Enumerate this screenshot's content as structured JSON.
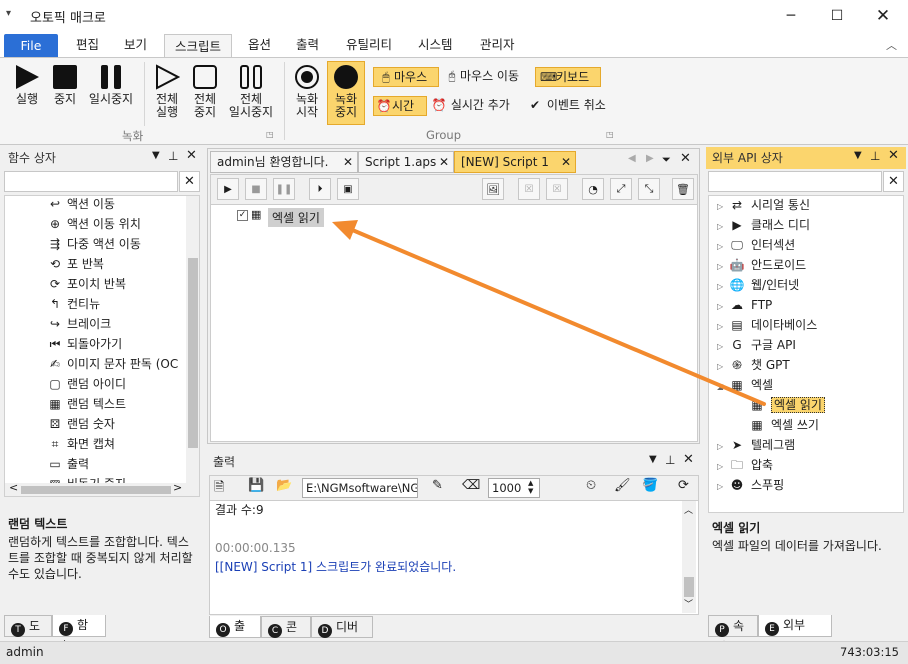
{
  "app": {
    "title": "오토픽 매크로"
  },
  "menu": {
    "items": [
      "File",
      "편집",
      "보기",
      "스크립트",
      "옵션",
      "출력",
      "유틸리티",
      "시스템",
      "관리자"
    ],
    "active": "스크립트"
  },
  "ribbon": {
    "run": "실행",
    "stop": "중지",
    "pause": "일시중지",
    "all_run": [
      "전체",
      "실행"
    ],
    "all_stop": [
      "전체",
      "중지"
    ],
    "all_pause": [
      "전체",
      "일시중지"
    ],
    "rec_start": [
      "녹화",
      "시작"
    ],
    "rec_stop": [
      "녹화",
      "중지"
    ],
    "mouse": "마우스",
    "mouse_move": "마우스 이동",
    "keyboard": "키보드",
    "time": "시간",
    "realtime_add": "실시간 추가",
    "event_cancel": "이벤트 취소",
    "group1": "녹화",
    "group2": "Group"
  },
  "left_panel": {
    "title": "함수 상자",
    "items": [
      "액션 이동",
      "액션 이동 위치",
      "다중 액션 이동",
      "포 반복",
      "포이치 반복",
      "컨티뉴",
      "브레이크",
      "되돌아가기",
      "이미지 문자 판독 (OC",
      "랜덤 아이디",
      "랜덤 텍스트",
      "랜덤 숫자",
      "화면 캡쳐",
      "출력",
      "비동기 중지"
    ],
    "desc_title": "랜덤 텍스트",
    "desc": "랜덤하게 텍스트를 조합합니다. 텍스트를 조합할 때 중복되지 않게 처리할수도 있습니다.",
    "tabs": [
      "도구",
      "함수"
    ]
  },
  "doc_tabs": [
    "admin님 환영합니다.",
    "Script 1.aps",
    "[NEW] Script 1"
  ],
  "script": {
    "node": "엑셀 읽기"
  },
  "output": {
    "title": "출력",
    "path": "E:\\NGMsoftware\\NG",
    "interval": "1000",
    "lines": [
      "결과 수:9",
      "",
      "00:00:00.135",
      "[[NEW] Script 1] 스크립트가 완료되었습니다."
    ],
    "tabs": [
      "출력",
      "콘솔",
      "디버그"
    ]
  },
  "right_panel": {
    "title": "외부 API 상자",
    "items": [
      "시리얼 통신",
      "클래스 디디",
      "인터섹션",
      "안드로이드",
      "웹/인터넷",
      "FTP",
      "데이타베이스",
      "구글 API",
      "챗 GPT",
      "엑셀",
      "엑셀 읽기",
      "엑셀 쓰기",
      "텔레그램",
      "압축",
      "스푸핑"
    ],
    "desc_title": "엑셀 읽기",
    "desc": "엑셀 파일의 데이터를 가져옵니다.",
    "tabs": [
      "속성",
      "외부 API"
    ]
  },
  "status": {
    "user": "admin",
    "time": "743:03:15"
  },
  "colors": {
    "accent": "#2b6fd6",
    "highlight": "#fbd56d",
    "arrow": "#f28a2e",
    "output_blue": "#1a3fb5"
  }
}
